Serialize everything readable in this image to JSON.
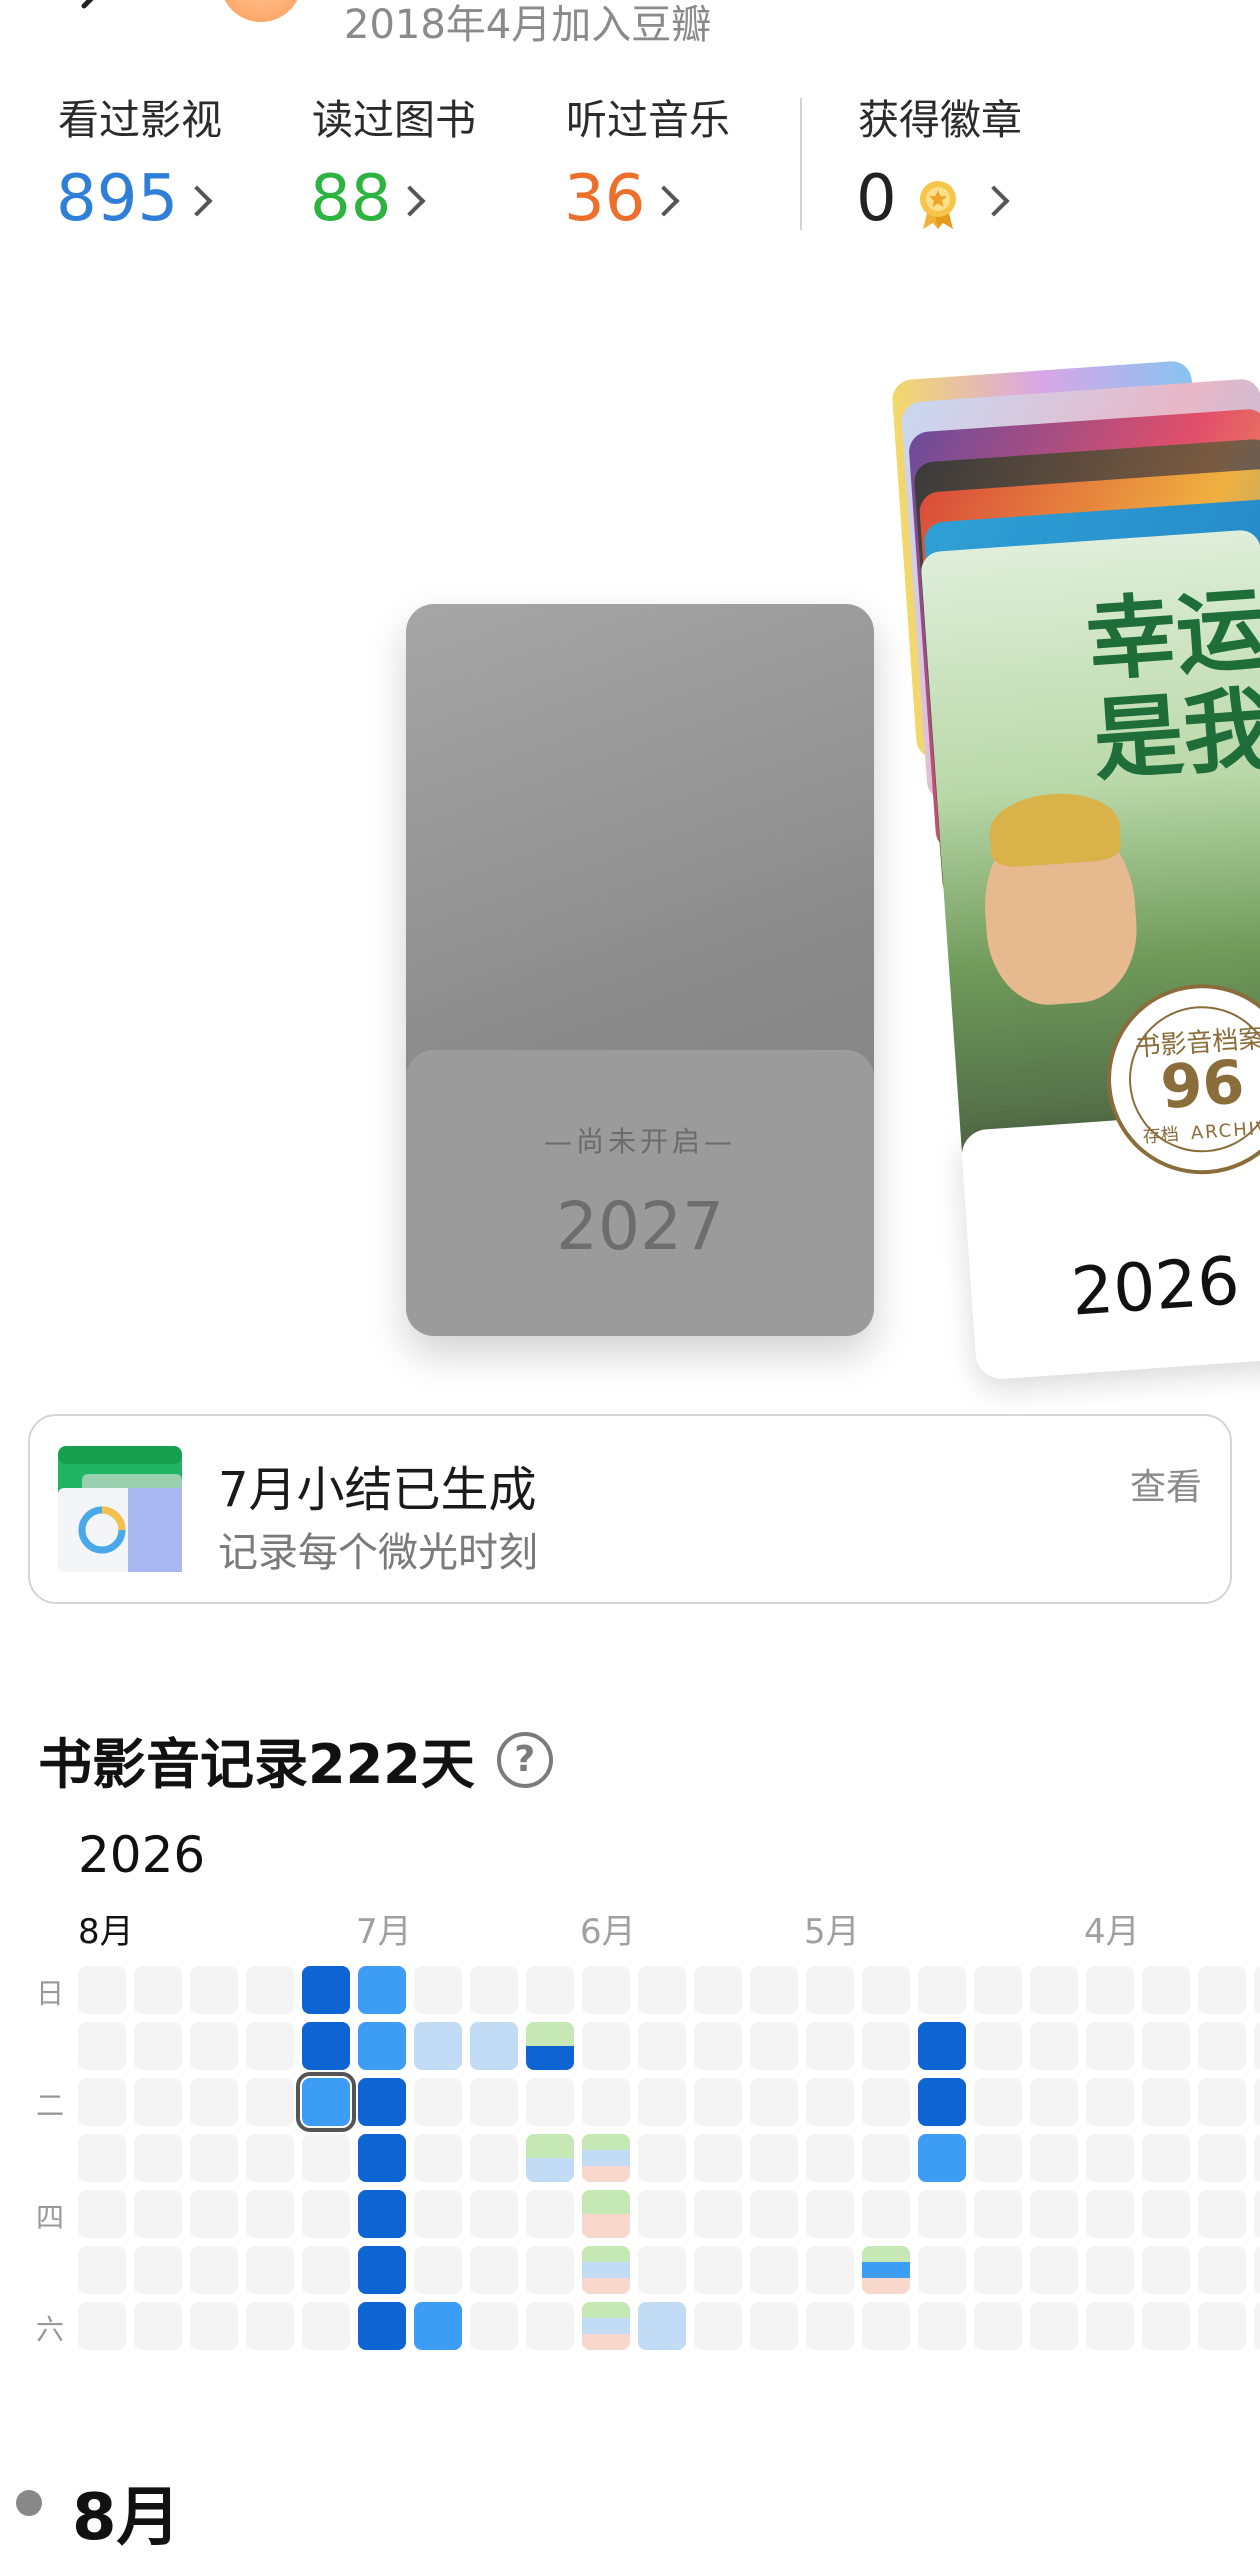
{
  "header": {
    "join_text": "2018年4月加入豆瓣"
  },
  "stats": [
    {
      "label": "看过影视",
      "value": "895",
      "color": "#2f7fd8"
    },
    {
      "label": "读过图书",
      "value": "88",
      "color": "#2db340"
    },
    {
      "label": "听过音乐",
      "value": "36",
      "color": "#ee6e2c"
    },
    {
      "label": "获得徽章",
      "value": "0",
      "color": "#222222"
    }
  ],
  "cards": {
    "future": {
      "status": "—尚未开启—",
      "year": "2027"
    },
    "current": {
      "year": "2026",
      "badge_number": "96",
      "badge_text": "书影音档案",
      "badge_sub": "存档",
      "badge_en": "ARCHIVE"
    },
    "poster_title": "幸运是我"
  },
  "banner": {
    "title": "7月小结已生成",
    "subtitle": "记录每个微光时刻",
    "action": "查看"
  },
  "record": {
    "title": "书影音记录222天",
    "year": "2026",
    "months": [
      "8月",
      "7月",
      "6月",
      "5月",
      "4月"
    ],
    "weekdays": [
      "日",
      "二",
      "四",
      "六"
    ]
  },
  "timeline": {
    "month": "8月"
  },
  "colors": {
    "dark_blue": "#0e64d2",
    "mid_blue": "#3d9df5",
    "light_blue": "#c3dcf5",
    "light_green": "#c6e8b4",
    "light_pink": "#f8d8cc",
    "empty": "#f4f4f4"
  }
}
